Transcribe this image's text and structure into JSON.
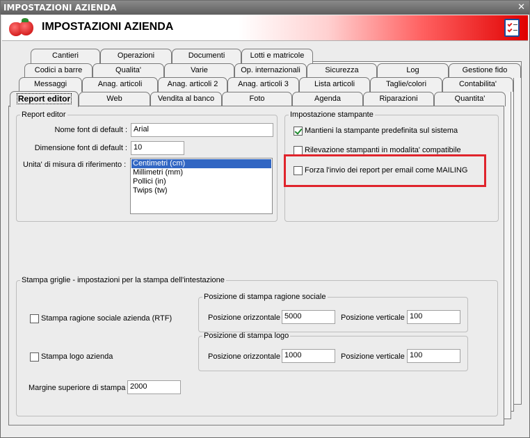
{
  "window": {
    "title": "IMPOSTAZIONI AZIENDA",
    "close_glyph": "✕"
  },
  "header": {
    "title": "IMPOSTAZIONI AZIENDA",
    "logo_icon": "strawberries-icon",
    "checklist_icon": "checklist-icon"
  },
  "tabs": {
    "row1": [
      "Cantieri",
      "Operazioni",
      "Documenti",
      "Lotti e matricole"
    ],
    "row2": [
      "Codici a barre",
      "Qualita'",
      "Varie",
      "Op. internazionali",
      "Sicurezza",
      "Log",
      "Gestione fido"
    ],
    "row3": [
      "Messaggi",
      "Anag. articoli",
      "Anag. articoli 2",
      "Anag. articoli 3",
      "Lista articoli",
      "Taglie/colori",
      "Contabilita'"
    ],
    "row4": [
      "Report editor",
      "Web",
      "Vendita al banco",
      "Foto",
      "Agenda",
      "Riparazioni",
      "Quantita'"
    ]
  },
  "report_editor": {
    "legend": "Report editor",
    "font_label": "Nome font di default :",
    "font_value": "Arial",
    "size_label": "Dimensione font di default :",
    "size_value": "10",
    "unit_label": "Unita' di misura di riferimento :",
    "unit_options": [
      "Centimetri (cm)",
      "Millimetri (mm)",
      "Pollici (in)",
      "Twips (tw)"
    ],
    "unit_selected": 0
  },
  "printer": {
    "legend": "Impostazione stampante",
    "keep_default": {
      "label": "Mantieni la stampante predefinita sul sistema",
      "checked": true
    },
    "compat": {
      "label": "Rilevazione stampanti in modalita' compatibile",
      "checked": false
    },
    "mailing": {
      "label": "Forza l'invio dei report per email come MAILING",
      "checked": false
    },
    "highlight_color": "#e0242c"
  },
  "grid_print": {
    "legend": "Stampa griglie - impostazioni per la stampa dell'intestazione",
    "company_name": {
      "label": "Stampa ragione sociale azienda (RTF)",
      "checked": false
    },
    "company_logo": {
      "label": "Stampa logo azienda",
      "checked": false
    },
    "name_pos": {
      "legend": "Posizione di stampa ragione sociale",
      "h_label": "Posizione orizzontale",
      "h_value": "5000",
      "v_label": "Posizione verticale",
      "v_value": "100"
    },
    "logo_pos": {
      "legend": "Posizione di stampa logo",
      "h_label": "Posizione orizzontale",
      "h_value": "1000",
      "v_label": "Posizione verticale",
      "v_value": "100"
    },
    "top_margin": {
      "label": "Margine superiore di stampa",
      "value": "2000"
    }
  }
}
